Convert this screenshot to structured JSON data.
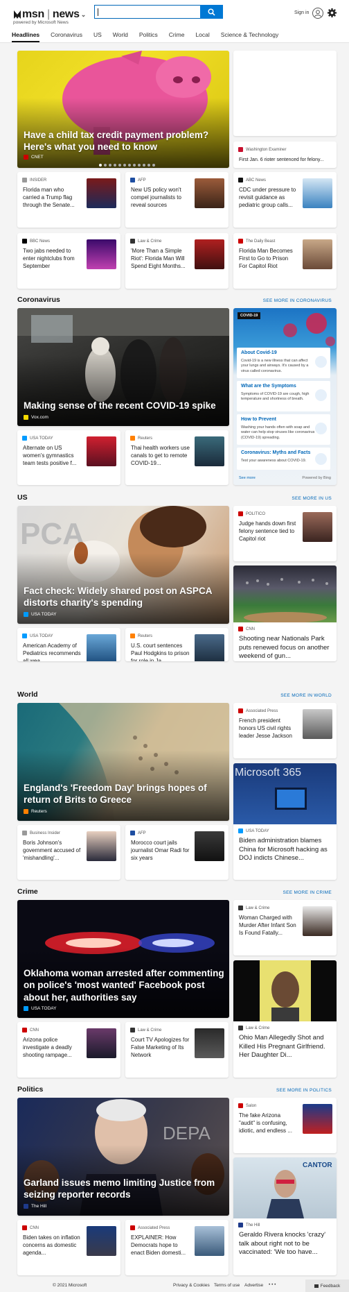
{
  "header": {
    "brand": "msn",
    "section": "news",
    "powered_by": "powered by Microsoft News",
    "search_placeholder": "",
    "signin": "Sign in"
  },
  "nav": [
    "Headlines",
    "Coronavirus",
    "US",
    "World",
    "Politics",
    "Crime",
    "Local",
    "Science & Technology"
  ],
  "headlines": {
    "hero": {
      "title": "Have a child tax credit payment problem? Here's what you need to know",
      "source": "CNET"
    },
    "side": {
      "source": "Washington Examiner",
      "title": "First Jan. 6 rioter sentenced for felony..."
    },
    "stories": [
      {
        "source": "INSIDER",
        "title": "Florida man who carried a Trump flag through the Senate..."
      },
      {
        "source": "AFP",
        "title": "New US policy won't compel journalists to reveal sources"
      },
      {
        "source": "ABC News",
        "title": "CDC under pressure to revisit guidance as pediatric group calls..."
      },
      {
        "source": "BBC News",
        "title": "Two jabs needed to enter nightclubs from September"
      },
      {
        "source": "Law & Crime",
        "title": "'More Than a Simple Riot': Florida Man Will Spend Eight Months..."
      },
      {
        "source": "The Daily Beast",
        "title": "Florida Man Becomes First to Go to Prison For Capitol Riot"
      }
    ]
  },
  "coronavirus": {
    "heading": "Coronavirus",
    "see_more": "SEE MORE IN CORONAVIRUS",
    "hero": {
      "title": "Making sense of the recent COVID-19 spike",
      "source": "Vox.com"
    },
    "panel": {
      "badge": "COVID-19",
      "items": [
        {
          "title": "About Covid-19",
          "desc": "Covid-19 is a new illness that can affect your lungs and airways. It's caused by a virus called coronavirus."
        },
        {
          "title": "What are the Symptoms",
          "desc": "Symptoms of COVID-19 are cough, high temperature and shortness of breath."
        },
        {
          "title": "How to Prevent",
          "desc": "Washing your hands often with soap and water can help stop viruses like coronavirus (COVID-19) spreading."
        },
        {
          "title": "Coronavirus: Myths and Facts",
          "desc": "Test your awareness about COVID-19."
        }
      ],
      "see_more": "See more",
      "powered": "Powered by Bing"
    },
    "stories": [
      {
        "source": "USA TODAY",
        "title": "Alternate on US women's gymnastics team tests positive f..."
      },
      {
        "source": "Reuters",
        "title": "Thai health workers use canals to get to remote COVID-19..."
      }
    ]
  },
  "us": {
    "heading": "US",
    "see_more": "SEE MORE IN US",
    "hero": {
      "title": "Fact check: Widely shared post on ASPCA distorts charity's spending",
      "source": "USA TODAY"
    },
    "side": {
      "source": "POLITICO",
      "title": "Judge hands down first felony sentence tied to Capitol riot"
    },
    "big": {
      "source": "CNN",
      "title": "Shooting near Nationals Park puts renewed focus on another weekend of gun..."
    },
    "stories": [
      {
        "source": "USA TODAY",
        "title": "American Academy of Pediatrics recommends all wea..."
      },
      {
        "source": "Reuters",
        "title": "U.S. court sentences Paul Hodgkins to prison for role in Ja..."
      }
    ]
  },
  "world": {
    "heading": "World",
    "see_more": "SEE MORE IN WORLD",
    "hero": {
      "title": "England's 'Freedom Day' brings hopes of return of Brits to Greece",
      "source": "Reuters"
    },
    "side": {
      "source": "Associated Press",
      "title": "French president honors US civil rights leader Jesse Jackson"
    },
    "big": {
      "source": "USA TODAY",
      "title": "Biden administration blames China for Microsoft hacking as DOJ indicts Chinese..."
    },
    "stories": [
      {
        "source": "Business Insider",
        "title": "Boris Johnson's government accused of 'mishandling'..."
      },
      {
        "source": "AFP",
        "title": "Morocco court jails journalist Omar Radi for six years"
      }
    ]
  },
  "crime": {
    "heading": "Crime",
    "see_more": "SEE MORE IN CRIME",
    "hero": {
      "title": "Oklahoma woman arrested after commenting on police's 'most wanted' Facebook post about her, authorities say",
      "source": "USA TODAY"
    },
    "side": {
      "source": "Law & Crime",
      "title": "Woman Charged with Murder After Infant Son Is Found Fatally..."
    },
    "big": {
      "source": "Law & Crime",
      "title": "Ohio Man Allegedly Shot and Killed His Pregnant Girlfriend. Her Daughter Di..."
    },
    "stories": [
      {
        "source": "CNN",
        "title": "Arizona police investigate a deadly shooting rampage..."
      },
      {
        "source": "Law & Crime",
        "title": "Court TV Apologizes for False Marketing of Its Network"
      }
    ]
  },
  "politics": {
    "heading": "Politics",
    "see_more": "SEE MORE IN POLITICS",
    "hero": {
      "title": "Garland issues memo limiting Justice from seizing reporter records",
      "source": "The Hill"
    },
    "side": {
      "source": "Salon",
      "title": "The fake Arizona \"audit\" is confusing, idiotic, and endless ..."
    },
    "big": {
      "source": "The Hill",
      "title": "Geraldo Rivera knocks 'crazy' talk about right not to be vaccinated: 'We too have..."
    },
    "stories": [
      {
        "source": "CNN",
        "title": "Biden takes on inflation concerns as domestic agenda..."
      },
      {
        "source": "Associated Press",
        "title": "EXPLAINER: How Democrats hope to enact Biden domesti..."
      }
    ]
  },
  "footer": {
    "copyright": "© 2021 Microsoft",
    "privacy": "Privacy & Cookies",
    "terms": "Terms of use",
    "advertise": "Advertise",
    "more": "• • •",
    "feedback": "Feedback"
  },
  "colors": {
    "accent": "#0078d4",
    "link": "#0067b8"
  }
}
